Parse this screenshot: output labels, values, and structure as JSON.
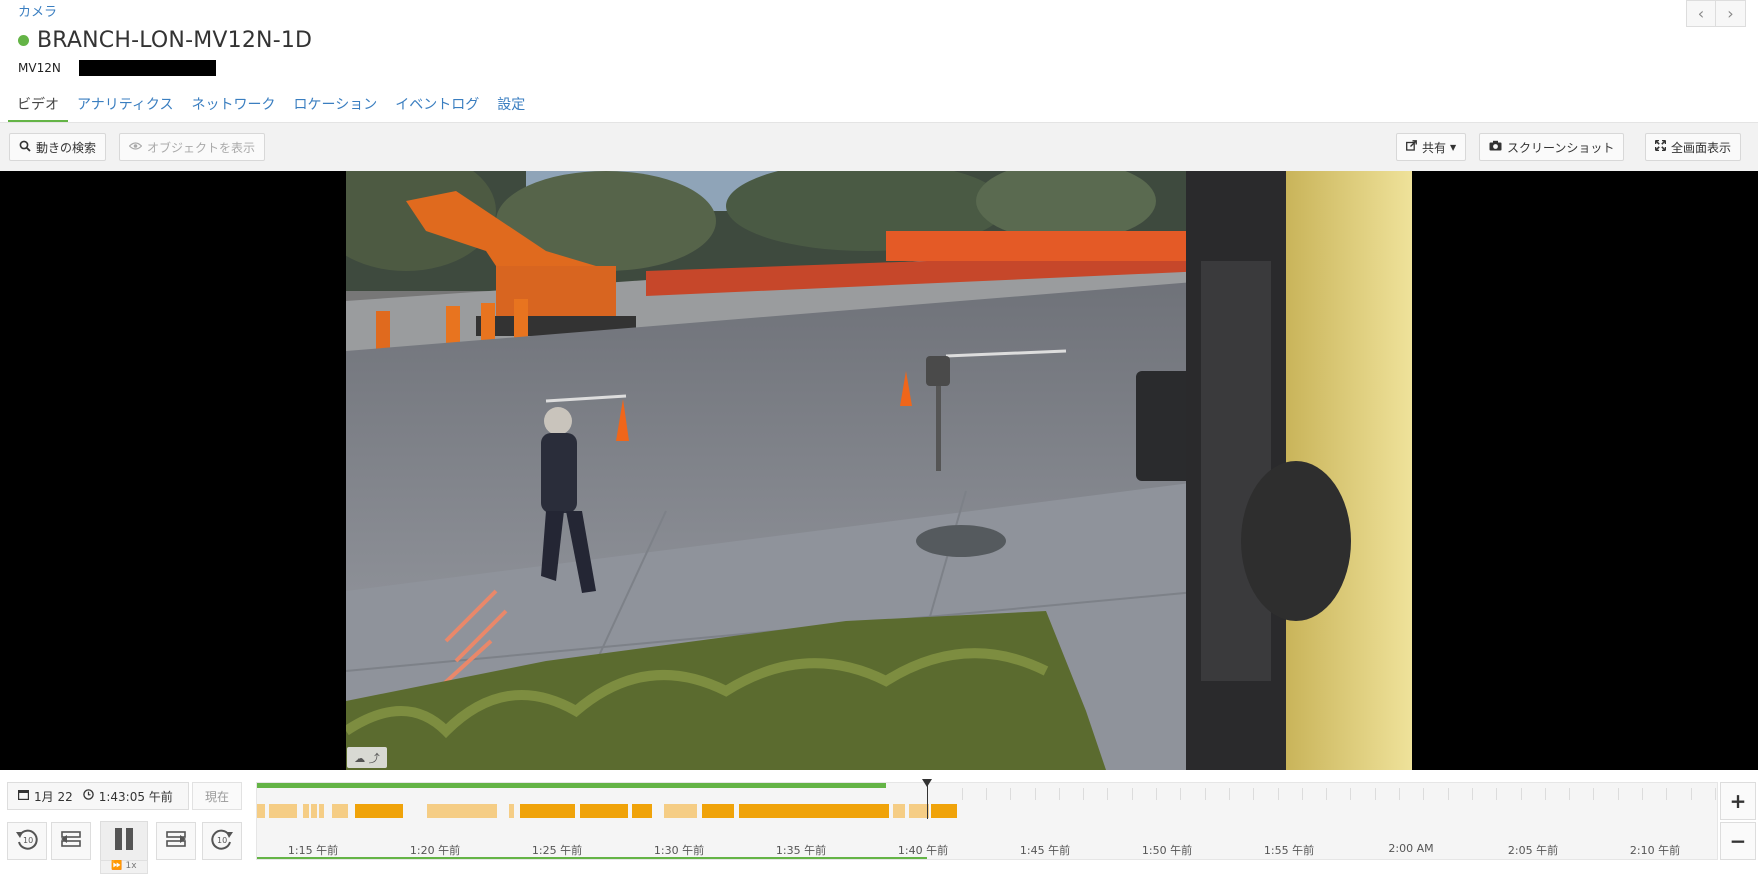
{
  "breadcrumb": "カメラ",
  "camera": {
    "name": "BRANCH-LON-MV12N-1D",
    "model": "MV12N",
    "status_color": "#64b446"
  },
  "tabs": [
    {
      "label": "ビデオ",
      "active": true
    },
    {
      "label": "アナリティクス",
      "active": false
    },
    {
      "label": "ネットワーク",
      "active": false
    },
    {
      "label": "ロケーション",
      "active": false
    },
    {
      "label": "イベントログ",
      "active": false
    },
    {
      "label": "設定",
      "active": false
    }
  ],
  "toolbar": {
    "motion_search": "動きの検索",
    "show_objects": "オブジェクトを表示",
    "share": "共有",
    "screenshot": "スクリーンショット",
    "fullscreen": "全画面表示"
  },
  "icons": {
    "search": "search-icon",
    "eye": "eye-icon",
    "share": "share-icon",
    "camera": "camera-icon",
    "expand": "expand-icon",
    "calendar": "calendar-icon",
    "clock": "clock-icon",
    "cloud": "cloud-icon"
  },
  "playback": {
    "date": "1月 22",
    "time": "1:43:05 午前",
    "now_label": "現在",
    "speed": "1x"
  },
  "timeline": {
    "labels": [
      "1:15 午前",
      "1:20 午前",
      "1:25 午前",
      "1:30 午前",
      "1:35 午前",
      "1:40 午前",
      "1:45 午前",
      "1:50 午前",
      "1:55 午前",
      "2:00 AM",
      "2:05 午前",
      "2:10 午前"
    ],
    "recorded_fraction": 0.43,
    "playhead_fraction": 0.4585,
    "motion_color": "#f0a30a",
    "motion_light_color": "#f5cd85"
  }
}
